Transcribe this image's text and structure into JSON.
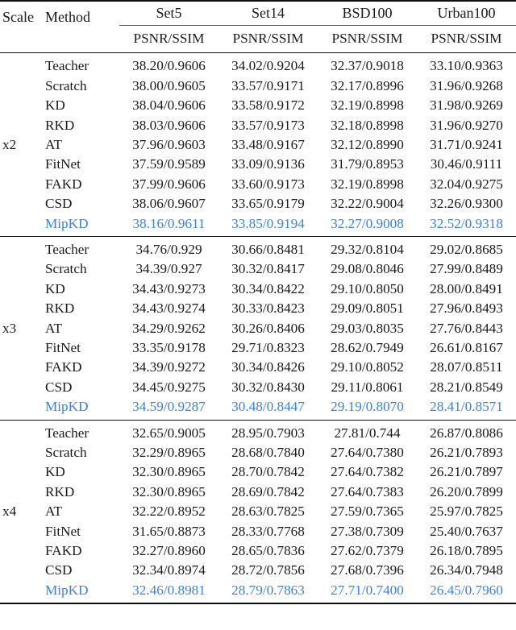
{
  "table": {
    "columns": {
      "scale_header": "Scale",
      "method_header": "Method",
      "groups": [
        "Set5",
        "Set14",
        "BSD100",
        "Urban100"
      ],
      "metric_header": "PSNR/SSIM"
    },
    "highlight_color": "#3b82e6",
    "highlight_method": "MipKD",
    "sections": [
      {
        "scale": "x2",
        "rows": [
          {
            "method": "Teacher",
            "Set5": "38.20/0.9606",
            "Set14": "34.02/0.9204",
            "BSD100": "32.37/0.9018",
            "Urban100": "33.10/0.9363",
            "highlight": false
          },
          {
            "method": "Scratch",
            "Set5": "38.00/0.9605",
            "Set14": "33.57/0.9171",
            "BSD100": "32.17/0.8996",
            "Urban100": "31.96/0.9268",
            "highlight": false
          },
          {
            "method": "KD",
            "Set5": "38.04/0.9606",
            "Set14": "33.58/0.9172",
            "BSD100": "32.19/0.8998",
            "Urban100": "31.98/0.9269",
            "highlight": false
          },
          {
            "method": "RKD",
            "Set5": "38.03/0.9606",
            "Set14": "33.57/0.9173",
            "BSD100": "32.18/0.8998",
            "Urban100": "31.96/0.9270",
            "highlight": false
          },
          {
            "method": "AT",
            "Set5": "37.96/0.9603",
            "Set14": "33.48/0.9167",
            "BSD100": "32.12/0.8990",
            "Urban100": "31.71/0.9241",
            "highlight": false
          },
          {
            "method": "FitNet",
            "Set5": "37.59/0.9589",
            "Set14": "33.09/0.9136",
            "BSD100": "31.79/0.8953",
            "Urban100": "30.46/0.9111",
            "highlight": false
          },
          {
            "method": "FAKD",
            "Set5": "37.99/0.9606",
            "Set14": "33.60/0.9173",
            "BSD100": "32.19/0.8998",
            "Urban100": "32.04/0.9275",
            "highlight": false
          },
          {
            "method": "CSD",
            "Set5": "38.06/0.9607",
            "Set14": "33.65/0.9179",
            "BSD100": "32.22/0.9004",
            "Urban100": "32.26/0.9300",
            "highlight": false
          },
          {
            "method": "MipKD",
            "Set5": "38.16/0.9611",
            "Set14": "33.85/0.9194",
            "BSD100": "32.27/0.9008",
            "Urban100": "32.52/0.9318",
            "highlight": true
          }
        ]
      },
      {
        "scale": "x3",
        "rows": [
          {
            "method": "Teacher",
            "Set5": "34.76/0.929",
            "Set14": "30.66/0.8481",
            "BSD100": "29.32/0.8104",
            "Urban100": "29.02/0.8685",
            "highlight": false
          },
          {
            "method": "Scratch",
            "Set5": "34.39/0.927",
            "Set14": "30.32/0.8417",
            "BSD100": "29.08/0.8046",
            "Urban100": "27.99/0.8489",
            "highlight": false
          },
          {
            "method": "KD",
            "Set5": "34.43/0.9273",
            "Set14": "30.34/0.8422",
            "BSD100": "29.10/0.8050",
            "Urban100": "28.00/0.8491",
            "highlight": false
          },
          {
            "method": "RKD",
            "Set5": "34.43/0.9274",
            "Set14": "30.33/0.8423",
            "BSD100": "29.09/0.8051",
            "Urban100": "27.96/0.8493",
            "highlight": false
          },
          {
            "method": "AT",
            "Set5": "34.29/0.9262",
            "Set14": "30.26/0.8406",
            "BSD100": "29.03/0.8035",
            "Urban100": "27.76/0.8443",
            "highlight": false
          },
          {
            "method": "FitNet",
            "Set5": "33.35/0.9178",
            "Set14": "29.71/0.8323",
            "BSD100": "28.62/0.7949",
            "Urban100": "26.61/0.8167",
            "highlight": false
          },
          {
            "method": "FAKD",
            "Set5": "34.39/0.9272",
            "Set14": "30.34/0.8426",
            "BSD100": "29.10/0.8052",
            "Urban100": "28.07/0.8511",
            "highlight": false
          },
          {
            "method": "CSD",
            "Set5": "34.45/0.9275",
            "Set14": "30.32/0.8430",
            "BSD100": "29.11/0.8061",
            "Urban100": "28.21/0.8549",
            "highlight": false
          },
          {
            "method": "MipKD",
            "Set5": "34.59/0.9287",
            "Set14": "30.48/0.8447",
            "BSD100": "29.19/0.8070",
            "Urban100": "28.41/0.8571",
            "highlight": true
          }
        ]
      },
      {
        "scale": "x4",
        "rows": [
          {
            "method": "Teacher",
            "Set5": "32.65/0.9005",
            "Set14": "28.95/0.7903",
            "BSD100": "27.81/0.744",
            "Urban100": "26.87/0.8086",
            "highlight": false
          },
          {
            "method": "Scratch",
            "Set5": "32.29/0.8965",
            "Set14": "28.68/0.7840",
            "BSD100": "27.64/0.7380",
            "Urban100": "26.21/0.7893",
            "highlight": false
          },
          {
            "method": "KD",
            "Set5": "32.30/0.8965",
            "Set14": "28.70/0.7842",
            "BSD100": "27.64/0.7382",
            "Urban100": "26.21/0.7897",
            "highlight": false
          },
          {
            "method": "RKD",
            "Set5": "32.30/0.8965",
            "Set14": "28.69/0.7842",
            "BSD100": "27.64/0.7383",
            "Urban100": "26.20/0.7899",
            "highlight": false
          },
          {
            "method": "AT",
            "Set5": "32.22/0.8952",
            "Set14": "28.63/0.7825",
            "BSD100": "27.59/0.7365",
            "Urban100": "25.97/0.7825",
            "highlight": false
          },
          {
            "method": "FitNet",
            "Set5": "31.65/0.8873",
            "Set14": "28.33/0.7768",
            "BSD100": "27.38/0.7309",
            "Urban100": "25.40/0.7637",
            "highlight": false
          },
          {
            "method": "FAKD",
            "Set5": "32.27/0.8960",
            "Set14": "28.65/0.7836",
            "BSD100": "27.62/0.7379",
            "Urban100": "26.18/0.7895",
            "highlight": false
          },
          {
            "method": "CSD",
            "Set5": "32.34/0.8974",
            "Set14": "28.72/0.7856",
            "BSD100": "27.68/0.7396",
            "Urban100": "26.34/0.7948",
            "highlight": false
          },
          {
            "method": "MipKD",
            "Set5": "32.46/0.8981",
            "Set14": "28.79/0.7863",
            "BSD100": "27.71/0.7400",
            "Urban100": "26.45/0.7960",
            "highlight": true
          }
        ]
      }
    ]
  }
}
